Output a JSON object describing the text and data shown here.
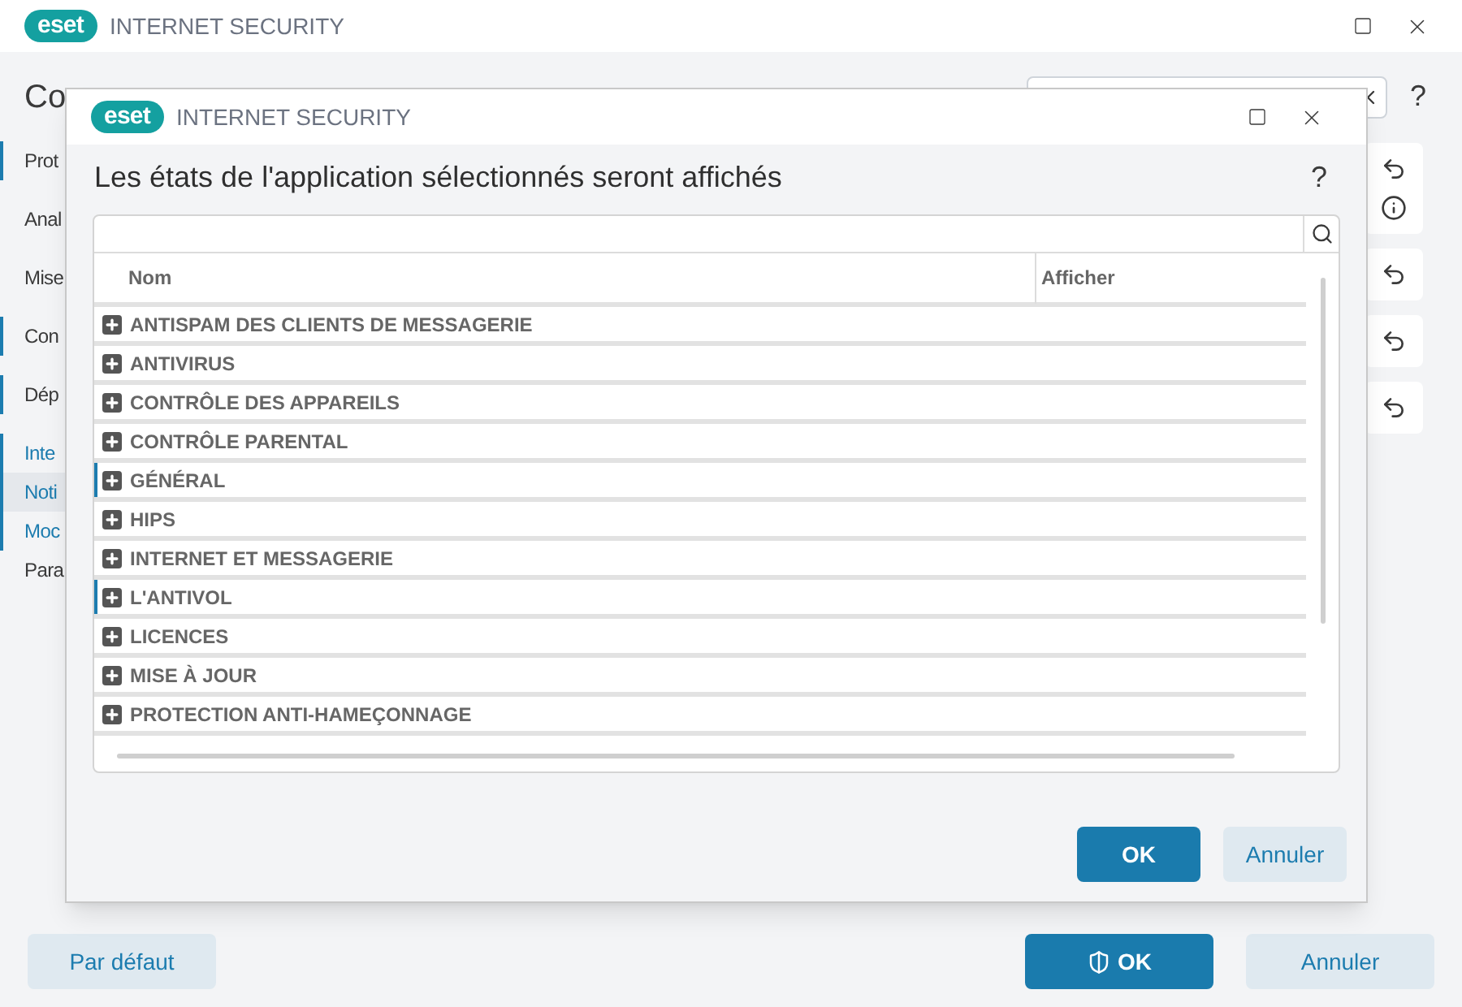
{
  "window": {
    "logo": "eset",
    "product": "INTERNET SECURITY",
    "page_title": "Co",
    "help": "?"
  },
  "sidebar": {
    "items": [
      {
        "label": "Prot",
        "marked": true,
        "selected": false,
        "link": false
      },
      {
        "label": "Anal",
        "marked": false,
        "selected": false,
        "link": false
      },
      {
        "label": "Mise",
        "marked": false,
        "selected": false,
        "link": false
      },
      {
        "label": "Con",
        "marked": true,
        "selected": false,
        "link": false
      },
      {
        "label": "Dép",
        "marked": true,
        "selected": false,
        "link": false
      },
      {
        "label": "Inte",
        "marked": true,
        "selected": false,
        "link": true
      },
      {
        "label": "Noti",
        "marked": true,
        "selected": true,
        "link": true
      },
      {
        "label": "Moc",
        "marked": true,
        "selected": false,
        "link": true
      },
      {
        "label": "Para",
        "marked": false,
        "selected": false,
        "link": false
      }
    ]
  },
  "side_cards": [
    {
      "info": true
    },
    {
      "info": false
    },
    {
      "info": false
    },
    {
      "info": false
    }
  ],
  "footer": {
    "default_button": "Par défaut",
    "ok_button": "OK",
    "cancel_button": "Annuler"
  },
  "dialog": {
    "logo": "eset",
    "product": "INTERNET SECURITY",
    "heading": "Les états de l'application sélectionnés seront affichés",
    "help": "?",
    "table": {
      "columns": [
        "Nom",
        "Afficher"
      ],
      "rows": [
        {
          "name": "ANTISPAM DES CLIENTS DE MESSAGERIE",
          "marked": false
        },
        {
          "name": "ANTIVIRUS",
          "marked": false
        },
        {
          "name": "CONTRÔLE DES APPAREILS",
          "marked": false
        },
        {
          "name": "CONTRÔLE PARENTAL",
          "marked": false
        },
        {
          "name": "GÉNÉRAL",
          "marked": true
        },
        {
          "name": "HIPS",
          "marked": false
        },
        {
          "name": "INTERNET ET MESSAGERIE",
          "marked": false
        },
        {
          "name": "L'ANTIVOL",
          "marked": true
        },
        {
          "name": "LICENCES",
          "marked": false
        },
        {
          "name": "MISE À JOUR",
          "marked": false
        },
        {
          "name": "PROTECTION ANTI-HAMEÇONNAGE",
          "marked": false
        }
      ]
    },
    "ok_button": "OK",
    "cancel_button": "Annuler"
  }
}
